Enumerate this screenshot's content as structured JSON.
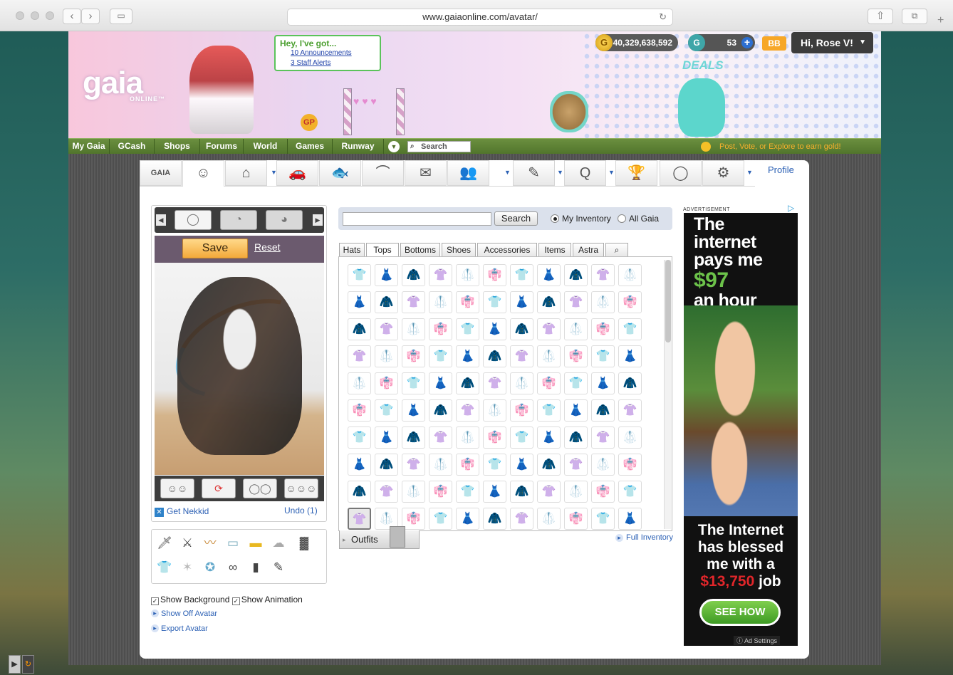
{
  "browser": {
    "url": "www.gaiaonline.com/avatar/"
  },
  "header": {
    "announce_title": "Hey, I've got...",
    "announcements": "10 Announcements",
    "staff_alerts": "3 Staff Alerts",
    "gold": "40,329,638,592",
    "gcash": "53",
    "bb": "BB",
    "user_greeting": "Hi, Rose V!",
    "deals": "DEALS",
    "logo": "gaia",
    "logo_sub": "ONLINE™"
  },
  "nav": {
    "items": [
      "My Gaia",
      "GCash",
      "Shops",
      "Forums",
      "World",
      "Games",
      "Runway"
    ],
    "search_placeholder": "Search",
    "earn_gold": "Post, Vote, or Explore to earn gold!"
  },
  "tabs": {
    "profile": "Profile",
    "gaia_label": "GAIA"
  },
  "avatar": {
    "save": "Save",
    "reset": "Reset",
    "get_nekkid": "Get Nekkid",
    "undo": "Undo (1)",
    "show_background": "Show Background",
    "show_animation": "Show Animation",
    "show_off": "Show Off Avatar",
    "export": "Export Avatar"
  },
  "inventory": {
    "search_button": "Search",
    "my_inventory": "My Inventory",
    "all_gaia": "All Gaia",
    "tabs": [
      "Hats",
      "Tops",
      "Bottoms",
      "Shoes",
      "Accessories",
      "Items",
      "Astra"
    ],
    "active_tab": "Tops",
    "outfits": "Outfits",
    "full_inventory": "Full Inventory"
  },
  "ad": {
    "label": "ADVERTISEMENT",
    "line1": "The",
    "line2": "internet",
    "line3": "pays me",
    "line4": "$97",
    "line5": "an hour",
    "line6": "The Internet",
    "line7": "has blessed",
    "line8": "me with a",
    "line9a": "$13,750",
    "line9b": "job",
    "cta": "SEE HOW",
    "settings": "Ad Settings"
  },
  "colors": {
    "nav_green": "#5a7f33",
    "link_blue": "#2e62b5",
    "bubble_green": "#5bc35b",
    "ad_green": "#6cc24a",
    "ad_red": "#e0262a"
  }
}
